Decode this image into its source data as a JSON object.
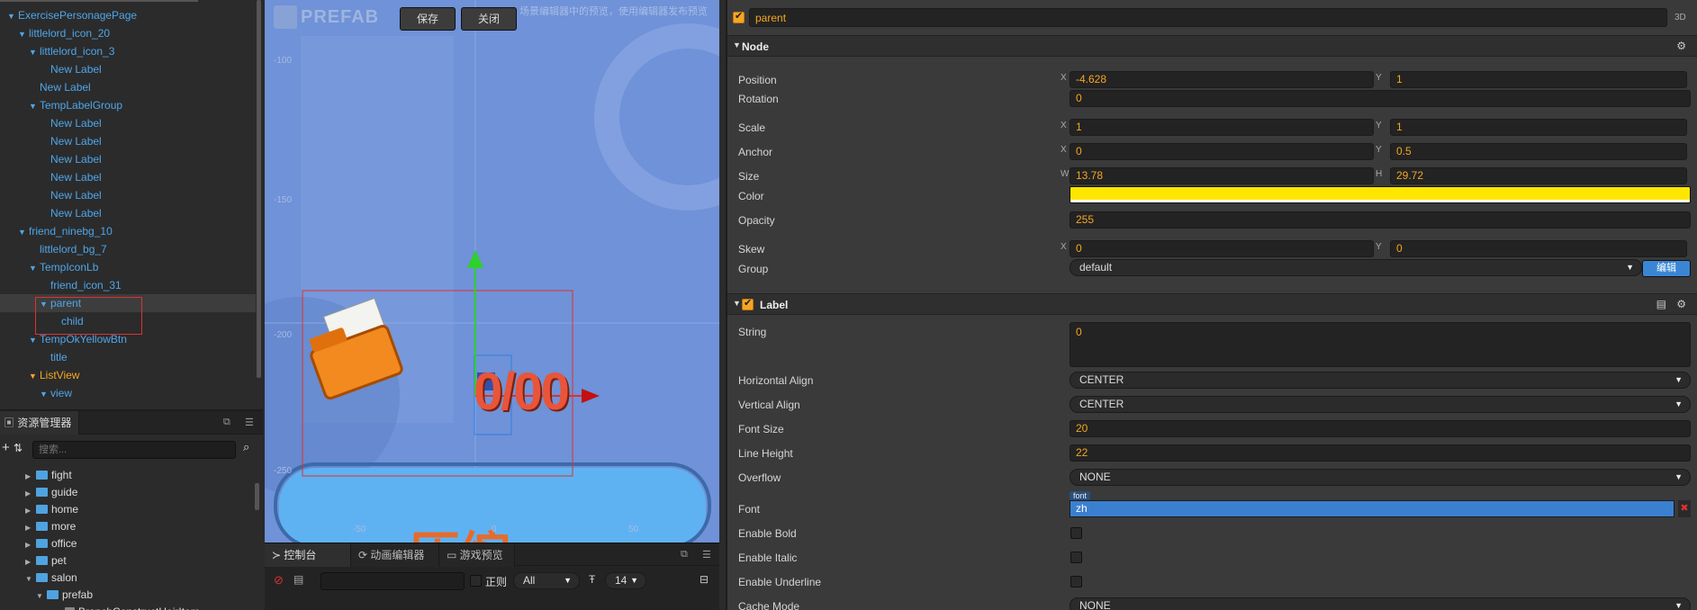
{
  "hierarchy": {
    "items": [
      {
        "label": "ExercisePersonagePage",
        "arrow": "▼"
      },
      {
        "label": "littlelord_icon_20",
        "arrow": "▼"
      },
      {
        "label": "littlelord_icon_3",
        "arrow": "▼"
      },
      {
        "label": "New Label",
        "arrow": ""
      },
      {
        "label": "New Label",
        "arrow": ""
      },
      {
        "label": "TempLabelGroup",
        "arrow": "▼"
      },
      {
        "label": "New Label",
        "arrow": ""
      },
      {
        "label": "New Label",
        "arrow": ""
      },
      {
        "label": "New Label",
        "arrow": ""
      },
      {
        "label": "New Label",
        "arrow": ""
      },
      {
        "label": "New Label",
        "arrow": ""
      },
      {
        "label": "New Label",
        "arrow": ""
      },
      {
        "label": "friend_ninebg_10",
        "arrow": "▼"
      },
      {
        "label": "littlelord_bg_7",
        "arrow": ""
      },
      {
        "label": "TempIconLb",
        "arrow": "▼"
      },
      {
        "label": "friend_icon_31",
        "arrow": ""
      },
      {
        "label": "parent",
        "arrow": "▼"
      },
      {
        "label": "child",
        "arrow": ""
      },
      {
        "label": "TempOkYellowBtn",
        "arrow": "▼"
      },
      {
        "label": "title",
        "arrow": ""
      },
      {
        "label": "ListView",
        "arrow": "▼"
      },
      {
        "label": "view",
        "arrow": "▼"
      }
    ]
  },
  "assets": {
    "title": "资源管理器",
    "search_placeholder": "搜索...",
    "items": [
      {
        "label": "fight",
        "arrow": "▶"
      },
      {
        "label": "guide",
        "arrow": "▶"
      },
      {
        "label": "home",
        "arrow": "▶"
      },
      {
        "label": "more",
        "arrow": "▶"
      },
      {
        "label": "office",
        "arrow": "▶"
      },
      {
        "label": "pet",
        "arrow": "▶"
      },
      {
        "label": "salon",
        "arrow": "▼"
      },
      {
        "label": "prefab",
        "arrow": "▼"
      },
      {
        "label": "BranchConstructHeirItem",
        "arrow": ""
      }
    ]
  },
  "scene": {
    "prefab_label": "PREFAB",
    "save": "保存",
    "close": "关闭",
    "hint": "场景编辑器中的预览，使用编辑器发布预览",
    "ruler_y": [
      "-100",
      "-150",
      "-200",
      "-250"
    ],
    "ruler_x": [
      "-50",
      "0",
      "50"
    ],
    "title_text": "0/00",
    "bottom_text": "压缩"
  },
  "console": {
    "tabs": [
      "控制台",
      "动画编辑器",
      "游戏预览"
    ],
    "regex": "正则",
    "filter": "All",
    "font_size": "14"
  },
  "inspector": {
    "node_name": "parent",
    "mode_3d": "3D",
    "node_section": "Node",
    "position_label": "Position",
    "pos_x": "-4.628",
    "pos_y": "1",
    "rotation_label": "Rotation",
    "rotation": "0",
    "scale_label": "Scale",
    "scale_x": "1",
    "scale_y": "1",
    "anchor_label": "Anchor",
    "anchor_x": "0",
    "anchor_y": "0.5",
    "size_label": "Size",
    "size_w": "13.78",
    "size_h": "29.72",
    "color_label": "Color",
    "color_value": "#ffe600",
    "opacity_label": "Opacity",
    "opacity": "255",
    "skew_label": "Skew",
    "skew_x": "0",
    "skew_y": "0",
    "group_label": "Group",
    "group": "default",
    "edit_button": "编辑",
    "label_section": "Label",
    "string_label": "String",
    "string_value": "0",
    "halign_label": "Horizontal Align",
    "halign": "CENTER",
    "valign_label": "Vertical Align",
    "valign": "CENTER",
    "fontsize_label": "Font Size",
    "fontsize": "20",
    "lineheight_label": "Line Height",
    "lineheight": "22",
    "overflow_label": "Overflow",
    "overflow": "NONE",
    "font_label": "Font",
    "font_tag": "font",
    "font_value": "zh",
    "bold_label": "Enable Bold",
    "italic_label": "Enable Italic",
    "underline_label": "Enable Underline",
    "cache_label": "Cache Mode",
    "cache": "NONE",
    "axes": {
      "x": "X",
      "y": "Y",
      "w": "W",
      "h": "H"
    }
  }
}
